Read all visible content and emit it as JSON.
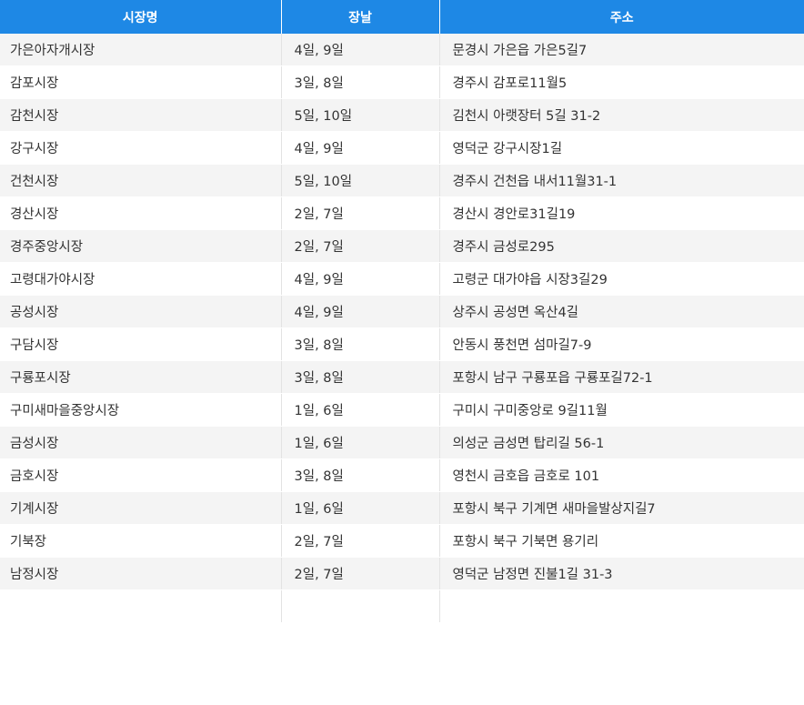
{
  "table": {
    "headers": [
      "시장명",
      "장날",
      "주소"
    ],
    "rows": [
      [
        "가은아자개시장",
        "4일, 9일",
        "문경시 가은읍 가은5길7"
      ],
      [
        "감포시장",
        "3일, 8일",
        "경주시 감포로11월5"
      ],
      [
        "감천시장",
        "5일, 10일",
        "김천시 아랫장터 5길 31-2"
      ],
      [
        "강구시장",
        "4일, 9일",
        "영덕군 강구시장1길"
      ],
      [
        "건천시장",
        "5일, 10일",
        "경주시 건천읍 내서11월31-1"
      ],
      [
        "경산시장",
        "2일, 7일",
        "경산시 경안로31길19"
      ],
      [
        "경주중앙시장",
        "2일, 7일",
        "경주시 금성로295"
      ],
      [
        "고령대가야시장",
        "4일, 9일",
        "고령군 대가야읍 시장3길29"
      ],
      [
        "공성시장",
        "4일, 9일",
        "상주시 공성면 옥산4길"
      ],
      [
        "구담시장",
        "3일, 8일",
        "안동시 풍천면 섬마길7-9"
      ],
      [
        "구룡포시장",
        "3일, 8일",
        "포항시 남구 구룡포읍 구룡포길72-1"
      ],
      [
        "구미새마을중앙시장",
        "1일, 6일",
        "구미시 구미중앙로 9길11월"
      ],
      [
        "금성시장",
        "1일, 6일",
        "의성군 금성면 탑리길 56-1"
      ],
      [
        "금호시장",
        "3일, 8일",
        "영천시 금호읍 금호로 101"
      ],
      [
        "기계시장",
        "1일, 6일",
        "포항시 북구 기계면 새마을발상지길7"
      ],
      [
        "기북장",
        "2일, 7일",
        "포항시 북구 기북면 용기리"
      ],
      [
        "남정시장",
        "2일, 7일",
        "영덕군 남정면 진불1길 31-3"
      ],
      [
        "",
        "",
        ""
      ]
    ]
  },
  "colors": {
    "header_bg": "#1e88e5",
    "header_text": "#ffffff",
    "row_odd_bg": "#f4f4f4",
    "row_even_bg": "#ffffff",
    "cell_text": "#333333"
  }
}
